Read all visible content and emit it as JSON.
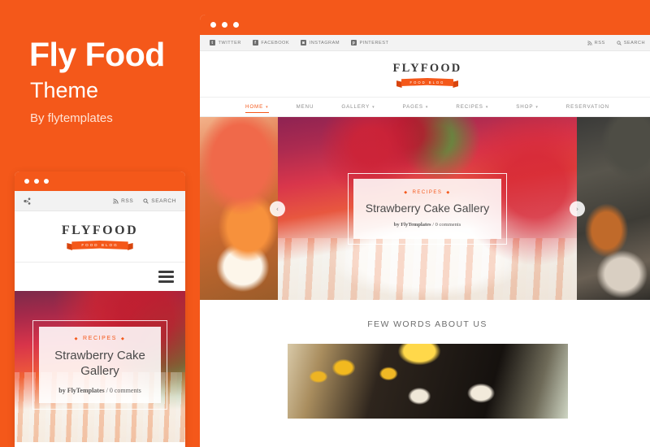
{
  "promo": {
    "title": "Fly Food",
    "subtitle": "Theme",
    "byline": "By flytemplates",
    "accent_color": "#F4581A"
  },
  "mobile_window": {
    "window_dots": "•••",
    "topbar": {
      "share_icon": "share-icon",
      "rss_label": "RSS",
      "search_label": "SEARCH"
    },
    "logo": {
      "text": "FLYFOOD",
      "ribbon": "FOOD BLOG"
    },
    "menu_icon": "hamburger-icon",
    "hero": {
      "category": "RECIPES",
      "diamond": "◆",
      "title": "Strawberry Cake Gallery",
      "author": "by FlyTemplates",
      "comments": "/ 0 comments"
    }
  },
  "desktop_window": {
    "window_dots": "•••",
    "topbar": {
      "social": [
        {
          "label": "TWITTER",
          "glyph": "t",
          "icon": "twitter-icon"
        },
        {
          "label": "FACEBOOK",
          "glyph": "f",
          "icon": "facebook-icon"
        },
        {
          "label": "INSTAGRAM",
          "glyph": "◙",
          "icon": "instagram-icon"
        },
        {
          "label": "PINTEREST",
          "glyph": "p",
          "icon": "pinterest-icon"
        }
      ],
      "rss_label": "RSS",
      "search_label": "SEARCH"
    },
    "logo": {
      "text": "FLYFOOD",
      "ribbon": "FOOD BLOG"
    },
    "nav": [
      {
        "label": "HOME",
        "has_caret": true,
        "active": true
      },
      {
        "label": "MENU",
        "has_caret": false,
        "active": false
      },
      {
        "label": "GALLERY",
        "has_caret": true,
        "active": false
      },
      {
        "label": "PAGES",
        "has_caret": true,
        "active": false
      },
      {
        "label": "RECIPES",
        "has_caret": true,
        "active": false
      },
      {
        "label": "SHOP",
        "has_caret": true,
        "active": false
      },
      {
        "label": "RESERVATION",
        "has_caret": false,
        "active": false
      }
    ],
    "slider": {
      "prev_arrow": "‹",
      "next_arrow": "›",
      "caption": {
        "category": "RECIPES",
        "diamond": "◆",
        "title": "Strawberry Cake Gallery",
        "author": "by FlyTemplates",
        "comments": "/ 0 comments"
      },
      "slides": [
        {
          "name": "salmon-sushi"
        },
        {
          "name": "strawberry-cake"
        },
        {
          "name": "chef-cooking"
        }
      ]
    },
    "about": {
      "heading": "FEW WORDS ABOUT US",
      "image_name": "restaurant-interior"
    }
  }
}
